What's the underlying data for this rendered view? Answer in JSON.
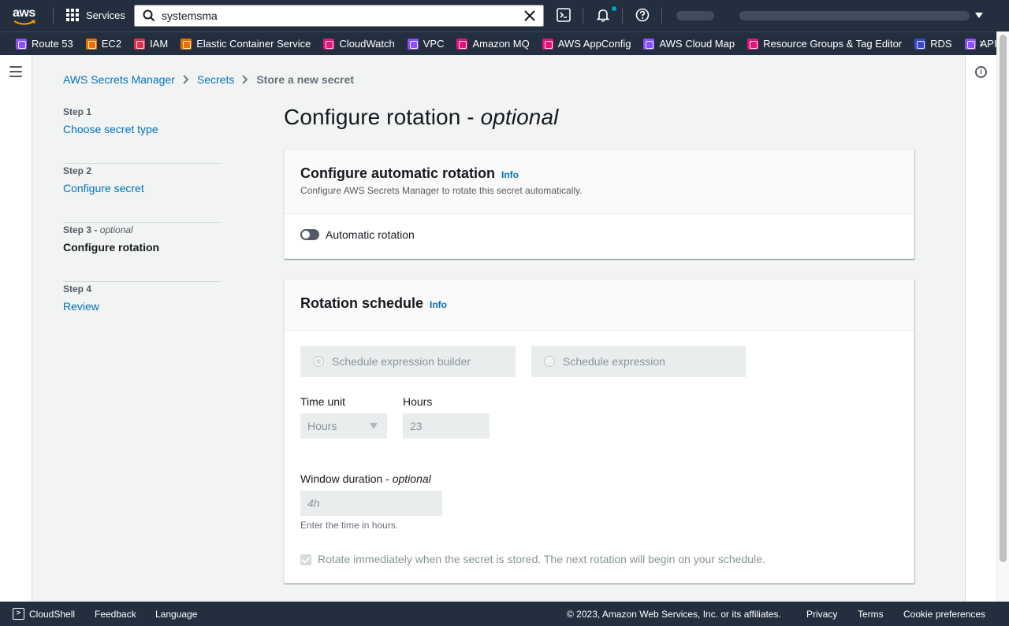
{
  "topnav": {
    "logo": "aws",
    "services_label": "Services",
    "search_value": "systemsma",
    "icons": [
      "grid-icon",
      "search-icon",
      "close-icon",
      "cloudshell-icon",
      "bell-icon",
      "help-icon"
    ]
  },
  "favorites": [
    {
      "label": "Route 53",
      "color": "#8c4fff"
    },
    {
      "label": "EC2",
      "color": "#ed7100"
    },
    {
      "label": "IAM",
      "color": "#dd344c"
    },
    {
      "label": "Elastic Container Service",
      "color": "#ed7100"
    },
    {
      "label": "CloudWatch",
      "color": "#e7157b"
    },
    {
      "label": "VPC",
      "color": "#8c4fff"
    },
    {
      "label": "Amazon MQ",
      "color": "#e7157b"
    },
    {
      "label": "AWS AppConfig",
      "color": "#e7157b"
    },
    {
      "label": "AWS Cloud Map",
      "color": "#8c4fff"
    },
    {
      "label": "Resource Groups & Tag Editor",
      "color": "#e7157b"
    },
    {
      "label": "RDS",
      "color": "#3b48cc"
    },
    {
      "label": "API G",
      "color": "#8c4fff"
    }
  ],
  "breadcrumb": {
    "root": "AWS Secrets Manager",
    "secrets": "Secrets",
    "current": "Store a new secret"
  },
  "steps": [
    {
      "number": "Step 1",
      "optional": "",
      "title": "Choose secret type"
    },
    {
      "number": "Step 2",
      "optional": "",
      "title": "Configure secret"
    },
    {
      "number": "Step 3",
      "optional": "optional",
      "title": "Configure rotation"
    },
    {
      "number": "Step 4",
      "optional": "",
      "title": "Review"
    }
  ],
  "page": {
    "title": "Configure rotation - ",
    "title_optional": "optional"
  },
  "auto_rotation": {
    "heading": "Configure automatic rotation",
    "info": "Info",
    "description": "Configure AWS Secrets Manager to rotate this secret automatically.",
    "toggle_label": "Automatic rotation",
    "enabled": false
  },
  "schedule": {
    "heading": "Rotation schedule",
    "info": "Info",
    "option_builder": "Schedule expression builder",
    "option_expression": "Schedule expression",
    "time_unit_label": "Time unit",
    "time_unit_value": "Hours",
    "hours_label": "Hours",
    "hours_value": "23",
    "window_label": "Window duration - ",
    "window_optional": "optional",
    "window_placeholder": "4h",
    "window_hint": "Enter the time in hours.",
    "rotate_immediately": "Rotate immediately when the secret is stored. The next rotation will begin on your schedule.",
    "rotate_checked": true
  },
  "footer": {
    "cloudshell": "CloudShell",
    "feedback": "Feedback",
    "language": "Language",
    "copyright": "© 2023, Amazon Web Services, Inc. or its affiliates.",
    "privacy": "Privacy",
    "terms": "Terms",
    "cookie": "Cookie preferences"
  }
}
